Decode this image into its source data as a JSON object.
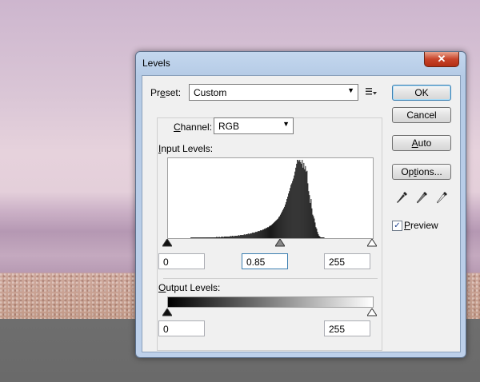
{
  "window": {
    "title": "Levels",
    "close_glyph": "✕"
  },
  "preset": {
    "label_pre": "Pr",
    "label_u": "e",
    "label_post": "set:",
    "value": "Custom"
  },
  "channel": {
    "label_u": "C",
    "label_post": "hannel:",
    "value": "RGB"
  },
  "input_levels": {
    "label_u": "I",
    "label_post": "nput Levels:",
    "black": "0",
    "gamma": "0.85",
    "white": "255",
    "gamma_fraction": 0.55
  },
  "output_levels": {
    "label_u": "O",
    "label_post": "utput Levels:",
    "black": "0",
    "white": "255"
  },
  "buttons": {
    "ok": "OK",
    "cancel": "Cancel",
    "auto_u": "A",
    "auto_post": "uto",
    "options_pre": "Op",
    "options_u": "t",
    "options_post": "ions..."
  },
  "preview": {
    "label_u": "P",
    "label_post": "review",
    "checked": true,
    "check_glyph": "✓"
  },
  "chart_data": {
    "type": "bar",
    "x_range": [
      0,
      255
    ],
    "histogram": [
      0,
      0,
      0,
      0,
      0,
      0,
      0,
      0,
      0,
      0,
      0,
      0,
      0,
      0,
      0,
      0,
      0,
      0,
      0,
      0,
      0,
      0,
      0,
      0,
      0,
      0,
      0,
      0,
      1,
      1,
      1,
      1,
      1,
      1,
      1,
      1,
      1,
      1,
      1,
      1,
      1,
      1,
      1,
      1,
      1,
      1,
      1,
      1,
      1,
      1,
      1,
      1,
      1,
      1,
      1,
      1,
      1,
      1,
      1,
      1,
      2,
      1,
      1,
      2,
      1,
      1,
      2,
      2,
      1,
      2,
      2,
      2,
      2,
      2,
      2,
      2,
      2,
      3,
      2,
      3,
      3,
      2,
      3,
      3,
      3,
      3,
      3,
      4,
      3,
      4,
      4,
      4,
      4,
      4,
      5,
      4,
      5,
      5,
      5,
      6,
      5,
      6,
      6,
      6,
      7,
      7,
      7,
      7,
      8,
      8,
      8,
      9,
      9,
      9,
      10,
      10,
      10,
      11,
      11,
      12,
      12,
      13,
      13,
      14,
      14,
      15,
      16,
      16,
      17,
      18,
      19,
      20,
      21,
      22,
      23,
      24,
      25,
      27,
      28,
      30,
      32,
      34,
      36,
      38,
      40,
      43,
      46,
      50,
      53,
      57,
      60,
      64,
      68,
      70,
      73,
      76,
      80,
      85,
      90,
      95,
      100,
      100,
      98,
      100,
      97,
      95,
      100,
      90,
      96,
      88,
      92,
      85,
      86,
      70,
      60,
      55,
      45,
      50,
      38,
      30,
      28,
      25,
      20,
      14,
      12,
      8,
      5,
      3,
      2,
      1,
      1,
      1,
      1,
      1,
      0,
      0,
      0,
      0,
      0,
      0,
      0,
      0,
      0,
      0,
      0,
      0,
      0,
      0,
      0,
      0,
      0,
      0,
      0,
      0,
      0,
      0,
      0,
      0,
      0,
      0,
      0,
      0,
      0,
      0,
      0,
      0,
      0,
      0,
      0,
      0,
      0,
      0,
      0,
      0,
      0,
      0,
      0,
      0,
      0,
      0,
      0,
      0,
      0,
      0,
      0,
      0,
      0,
      0,
      0,
      0,
      0,
      0,
      0,
      0
    ]
  }
}
